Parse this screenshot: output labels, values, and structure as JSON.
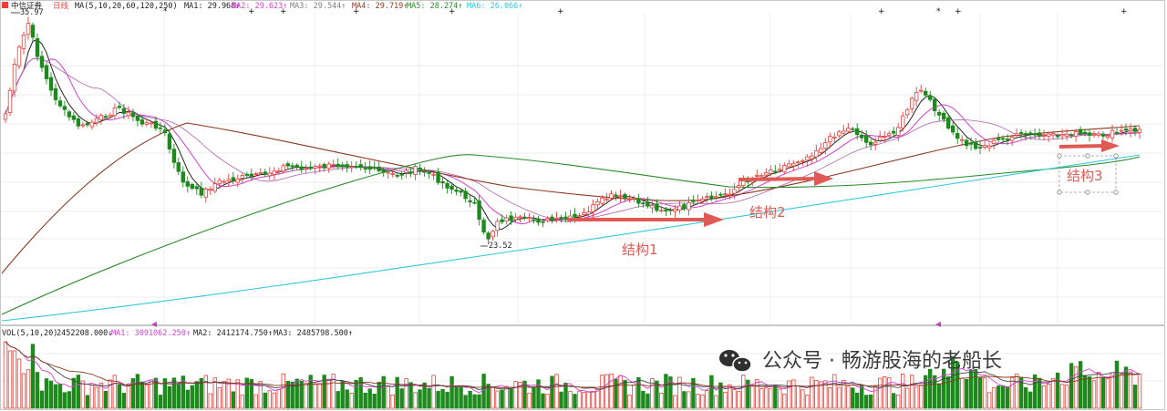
{
  "header": {
    "icon_name": "stock-flag-icon",
    "stock_name": "中信证券",
    "period": "日线",
    "ma_params": "MA(5,10,20,60,120,250)",
    "ma1": "MA1: 29.968↑",
    "ma2": "MA2: 29.623↑",
    "ma3": "MA3: 29.544↑",
    "ma4": "MA4: 29.719↑",
    "ma5": "MA5: 28.274↑",
    "ma6": "MA6: 26.066↑"
  },
  "price_chart": {
    "high_label": "35.97",
    "low_label": "23.52",
    "structure_labels": [
      "结构1",
      "结构2",
      "结构3"
    ]
  },
  "volume_header": {
    "title": "VOL(5,10,20)",
    "value": "2452208.000↓",
    "ma1": "MA1: 3091062.250↑",
    "ma2": "MA2: 2412174.750↑",
    "ma3": "MA3: 2485798.500↑"
  },
  "watermark": {
    "icon_name": "wechat-icon",
    "text": "公众号 · 畅游股海的老船长"
  },
  "colors": {
    "up": "#e8403a",
    "down": "#1e8a1e",
    "ma1": "#222222",
    "ma2": "#d040d0",
    "ma3": "#b060b0",
    "ma4": "#8b3a20",
    "ma5": "#2a8a2a",
    "ma6": "#33c8d8",
    "arrow": "#e05a55"
  },
  "chart_data": {
    "type": "candlestick",
    "price_range_visible": [
      23.52,
      35.97
    ],
    "annotations": [
      "35.97",
      "23.52",
      "结构1",
      "结构2",
      "结构3"
    ],
    "moving_averages": [
      "MA1",
      "MA2",
      "MA3",
      "MA4",
      "MA5",
      "MA6"
    ],
    "volume_moving_averages": [
      "MA1",
      "MA2",
      "MA3"
    ]
  }
}
